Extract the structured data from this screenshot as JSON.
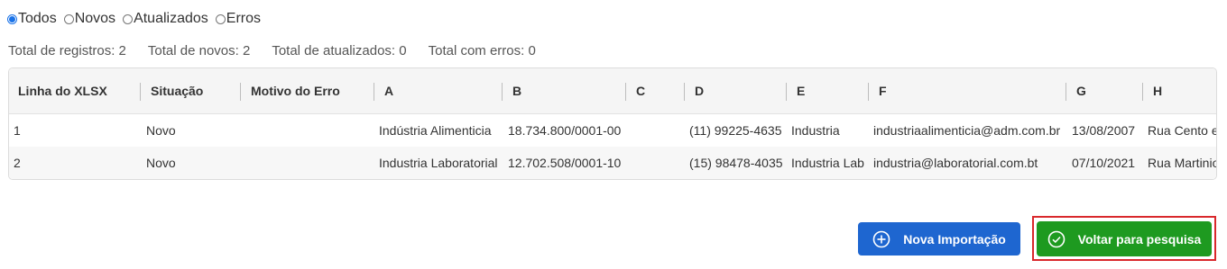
{
  "filter": {
    "options": [
      {
        "label": "Todos",
        "checked": true
      },
      {
        "label": "Novos",
        "checked": false
      },
      {
        "label": "Atualizados",
        "checked": false
      },
      {
        "label": "Erros",
        "checked": false
      }
    ]
  },
  "totals": {
    "registros": "Total de registros: 2",
    "novos": "Total de novos: 2",
    "atualizados": "Total de atualizados: 0",
    "erros": "Total com erros: 0"
  },
  "table": {
    "headers": [
      "Linha do XLSX",
      "Situação",
      "Motivo do Erro",
      "A",
      "B",
      "C",
      "D",
      "E",
      "F",
      "G",
      "H"
    ],
    "rows": [
      [
        "1",
        "Novo",
        "",
        "Indústria Alimenticia",
        "18.734.800/0001-00",
        "",
        "(11) 99225-4635",
        "Industria",
        "industriaalimenticia@adm.com.br",
        "13/08/2007",
        "Rua Cento e"
      ],
      [
        "2",
        "Novo",
        "",
        "Industria Laboratorial",
        "12.702.508/0001-10",
        "",
        "(15) 98478-4035",
        "Industria Lab",
        "industria@laboratorial.com.bt",
        "07/10/2021",
        "Rua Martinio"
      ]
    ]
  },
  "buttons": {
    "new_import": "Nova Importação",
    "back_to_search": "Voltar para pesquisa"
  },
  "colors": {
    "primary_blue": "#1e66d0",
    "success_green": "#1e9a20",
    "highlight_red": "#d9282c",
    "radio_blue": "#1a73e8"
  },
  "icons": {
    "new_import": "plus-circle-icon",
    "back_to_search": "check-circle-icon"
  }
}
